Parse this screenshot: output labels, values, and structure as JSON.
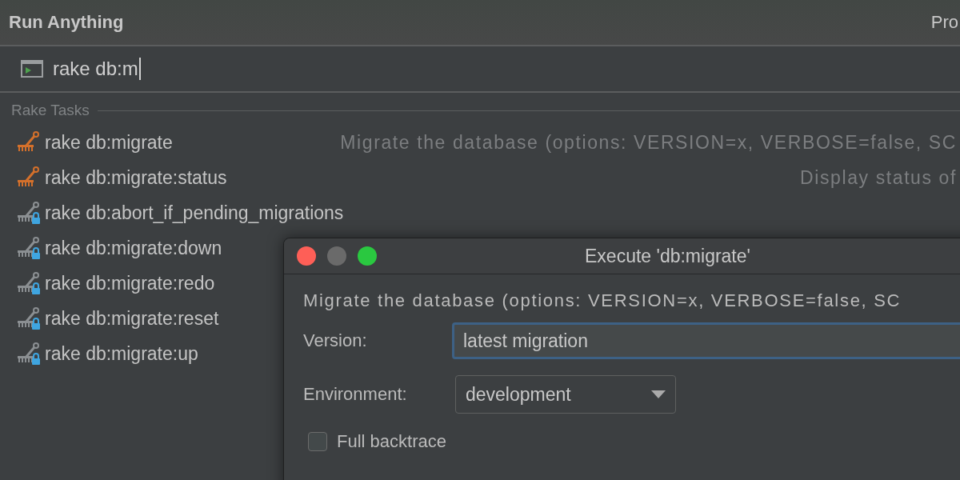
{
  "header": {
    "title": "Run Anything",
    "right_text": "Pro"
  },
  "search": {
    "value": "rake db:m"
  },
  "section": {
    "label": "Rake Tasks"
  },
  "tasks": [
    {
      "kind": "primary",
      "name": "rake db:migrate",
      "description": "Migrate the database (options: VERSION=x, VERBOSE=false, SC"
    },
    {
      "kind": "primary",
      "name": "rake db:migrate:status",
      "description": "Display status of"
    },
    {
      "kind": "locked",
      "name": "rake db:abort_if_pending_migrations"
    },
    {
      "kind": "locked",
      "name": "rake db:migrate:down"
    },
    {
      "kind": "locked",
      "name": "rake db:migrate:redo"
    },
    {
      "kind": "locked",
      "name": "rake db:migrate:reset"
    },
    {
      "kind": "locked",
      "name": "rake db:migrate:up"
    }
  ],
  "dialog": {
    "title": "Execute 'db:migrate'",
    "description": "Migrate the database (options: VERSION=x, VERBOSE=false, SC",
    "version_label": "Version:",
    "version_value": "latest migration",
    "environment_label": "Environment:",
    "environment_value": "development",
    "checkbox": {
      "label": "Full backtrace",
      "checked": false
    }
  }
}
